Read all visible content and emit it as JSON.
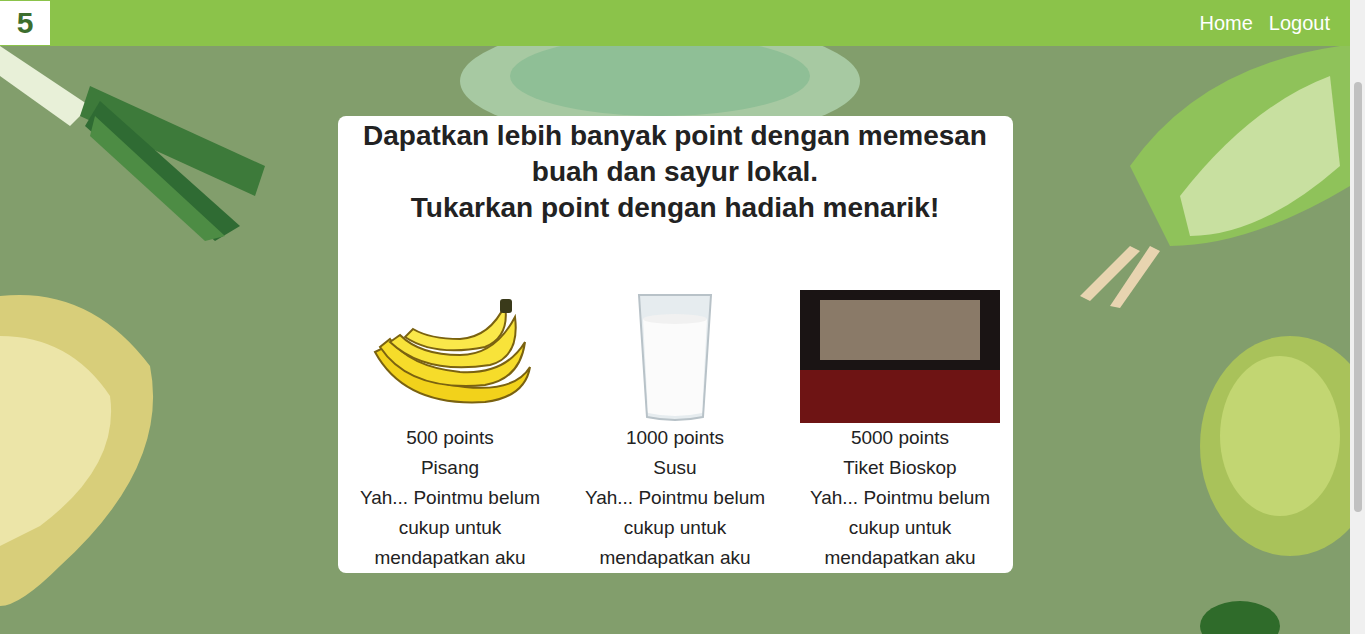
{
  "logo": {
    "mark": "5"
  },
  "nav": {
    "links": [
      "Home",
      "Logout"
    ]
  },
  "card": {
    "title_lines": [
      "Dapatkan lebih banyak point dengan memesan buah dan sayur lokal.",
      "Tukarkan point dengan hadiah menarik!"
    ],
    "rewards": [
      {
        "kind": "banana",
        "points": "500 points",
        "name": "Pisang",
        "message": "Yah... Pointmu belum cukup untuk mendapatkan aku"
      },
      {
        "kind": "milk",
        "points": "1000 points",
        "name": "Susu",
        "message": "Yah... Pointmu belum cukup untuk mendapatkan aku"
      },
      {
        "kind": "photo",
        "points": "5000 points",
        "name": "Tiket Bioskop",
        "message": "Yah... Pointmu belum cukup untuk mendapatkan aku"
      }
    ]
  }
}
